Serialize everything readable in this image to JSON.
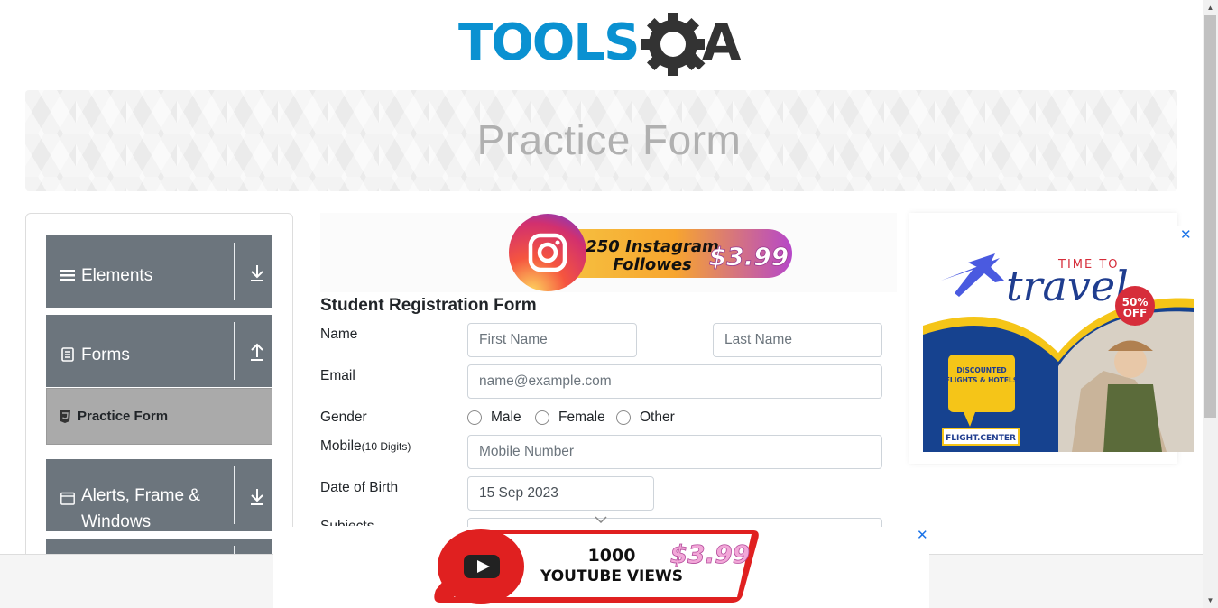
{
  "brand": {
    "logo_text": "TOOLS",
    "logo_suffix": "A"
  },
  "page": {
    "title": "Practice Form"
  },
  "sidebar": {
    "groups": [
      {
        "label": "Elements",
        "icon": "hamburger-icon",
        "arrow": "download-arrow-icon"
      },
      {
        "label": "Forms",
        "icon": "document-icon",
        "arrow": "upload-arrow-icon"
      },
      {
        "label": "Alerts, Frame &",
        "label2": "Windows",
        "icon": "window-icon",
        "arrow": "download-arrow-icon"
      }
    ],
    "active_item": {
      "label": "Practice Form",
      "icon": "html5-shield-icon"
    }
  },
  "ads": {
    "instagram": {
      "line1": "250 Instagram",
      "line2": "Followes",
      "price": "$3.99"
    },
    "travel": {
      "line1": "TIME TO",
      "line2": "travel",
      "discount": "50%",
      "discount2": "OFF",
      "bubble1": "DISCOUNTED",
      "bubble2": "FLIGHTS & HOTELS",
      "brand": "FLIGHT.CENTER",
      "close": "✕"
    },
    "youtube": {
      "line1": "1000",
      "line2": "YOUTUBE VIEWS",
      "price": "$3.99",
      "close": "✕"
    }
  },
  "form": {
    "title": "Student Registration Form",
    "name_label": "Name",
    "first_name_placeholder": "First Name",
    "last_name_placeholder": "Last Name",
    "email_label": "Email",
    "email_placeholder": "name@example.com",
    "gender_label": "Gender",
    "gender_options": [
      "Male",
      "Female",
      "Other"
    ],
    "mobile_label": "Mobile",
    "mobile_hint": "(10 Digits)",
    "mobile_placeholder": "Mobile Number",
    "dob_label": "Date of Birth",
    "dob_value": "15 Sep 2023",
    "subjects_label": "Subjects"
  },
  "colors": {
    "sidebar_group": "#6c757d",
    "active_item": "#aaaaaa",
    "logo_blue": "#0a91d1",
    "logo_dark": "#333333",
    "link_blue": "#1a73e8"
  }
}
